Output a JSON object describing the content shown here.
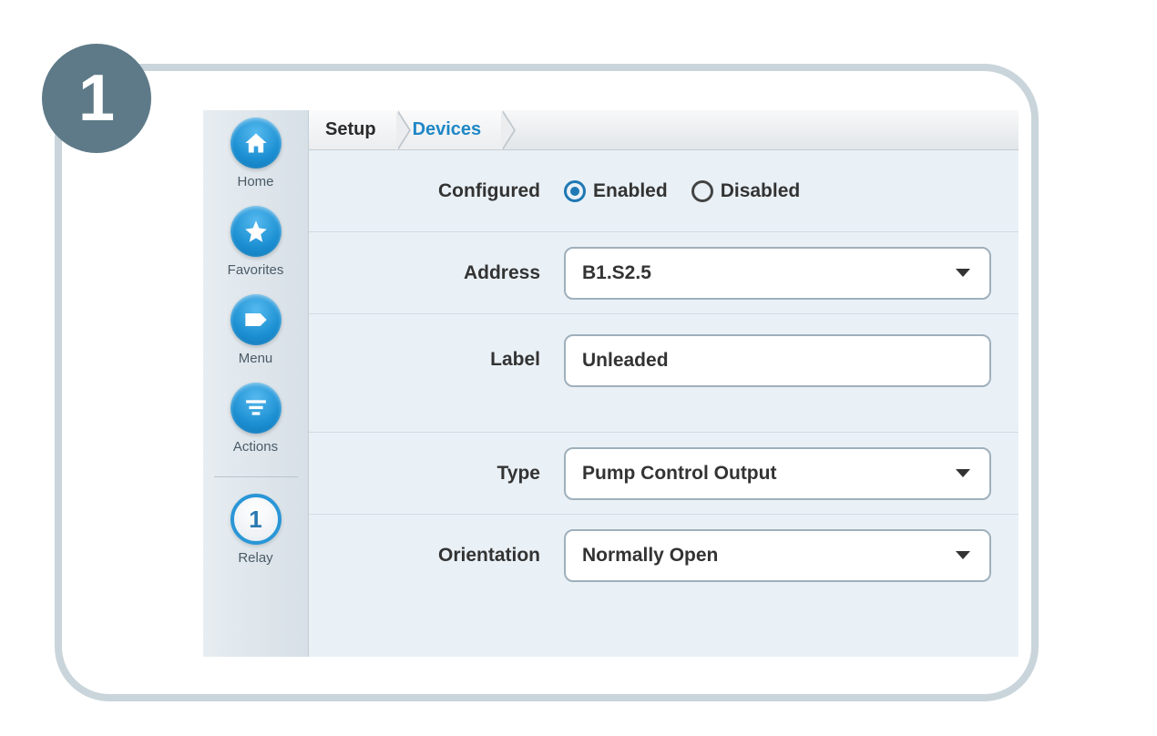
{
  "step": "1",
  "sidebar": {
    "home": "Home",
    "favorites": "Favorites",
    "menu": "Menu",
    "actions": "Actions",
    "relay_num": "1",
    "relay_label": "Relay"
  },
  "breadcrumb": {
    "setup": "Setup",
    "devices": "Devices"
  },
  "form": {
    "configured_label": "Configured",
    "enabled_label": "Enabled",
    "disabled_label": "Disabled",
    "address_label": "Address",
    "address_value": "B1.S2.5",
    "label_label": "Label",
    "label_value": "Unleaded",
    "type_label": "Type",
    "type_value": "Pump Control Output",
    "orientation_label": "Orientation",
    "orientation_value": "Normally Open"
  }
}
